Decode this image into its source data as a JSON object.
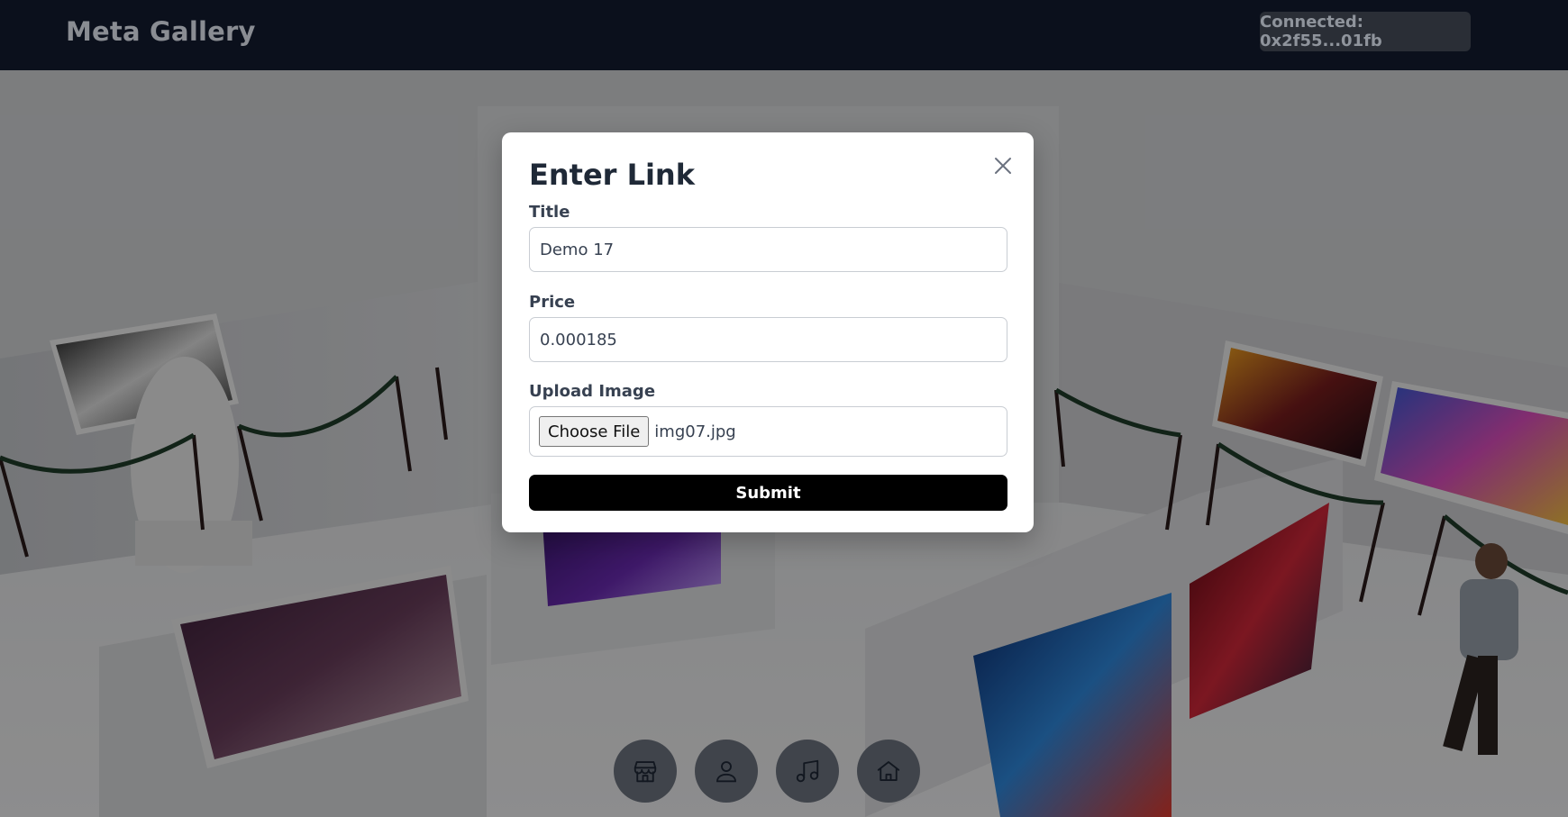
{
  "header": {
    "brand": "Meta Gallery",
    "wallet_status": "Connected: 0x2f55...01fb"
  },
  "modal": {
    "title": "Enter Link",
    "title_field": {
      "label": "Title",
      "value": "Demo 17"
    },
    "price_field": {
      "label": "Price",
      "value": "0.000185"
    },
    "upload_field": {
      "label": "Upload Image",
      "button": "Choose File",
      "file_name": "img07.jpg"
    },
    "submit_label": "Submit"
  },
  "bottom_nav": {
    "items": [
      {
        "icon": "store-icon"
      },
      {
        "icon": "user-icon"
      },
      {
        "icon": "music-icon"
      },
      {
        "icon": "home-icon"
      }
    ]
  },
  "colors": {
    "topbar": "#0b101c",
    "accent": "#000000",
    "overlay": "rgba(0,0,0,0.42)"
  }
}
